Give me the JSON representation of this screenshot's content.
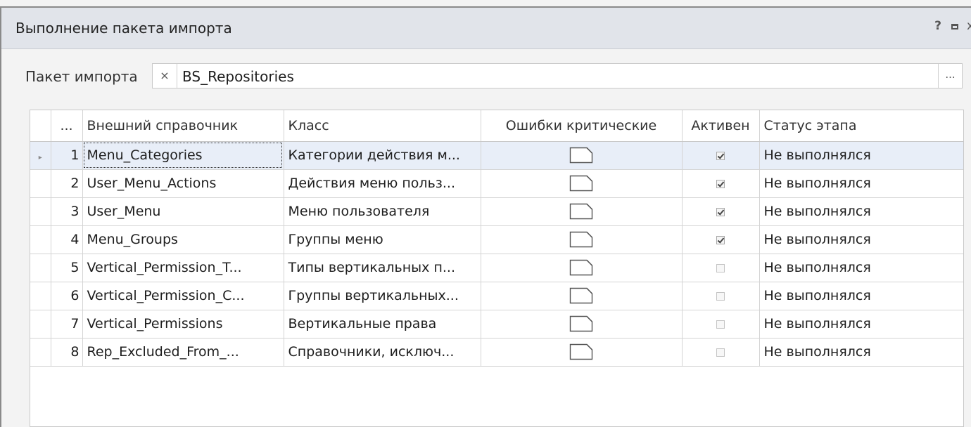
{
  "window": {
    "title": "Выполнение пакета импорта",
    "help_glyph": "?",
    "close_glyph": "x"
  },
  "package": {
    "label": "Пакет импорта",
    "clear_glyph": "×",
    "value": "BS_Repositories",
    "browse_glyph": "..."
  },
  "grid": {
    "columns": {
      "num": "...",
      "external": "Внешний справочник",
      "class": "Класс",
      "errors": "Ошибки критические",
      "active": "Активен",
      "status": "Статус этапа"
    },
    "rows": [
      {
        "num": "1",
        "external": "Menu_Categories",
        "class": "Категории действия м...",
        "active": true,
        "status": "Не выполнялся",
        "selected": true
      },
      {
        "num": "2",
        "external": "User_Menu_Actions",
        "class": "Действия меню польз...",
        "active": true,
        "status": "Не выполнялся"
      },
      {
        "num": "3",
        "external": "User_Menu",
        "class": "Меню пользователя",
        "active": true,
        "status": "Не выполнялся"
      },
      {
        "num": "4",
        "external": "Menu_Groups",
        "class": "Группы меню",
        "active": true,
        "status": "Не выполнялся"
      },
      {
        "num": "5",
        "external": "Vertical_Permission_T...",
        "class": "Типы вертикальных п...",
        "active": false,
        "status": "Не выполнялся"
      },
      {
        "num": "6",
        "external": "Vertical_Permission_C...",
        "class": "Группы вертикальных...",
        "active": false,
        "status": "Не выполнялся"
      },
      {
        "num": "7",
        "external": "Vertical_Permissions",
        "class": "Вертикальные права",
        "active": false,
        "status": "Не выполнялся"
      },
      {
        "num": "8",
        "external": "Rep_Excluded_From_...",
        "class": "Справочники, исключ...",
        "active": false,
        "status": "Не выполнялся"
      }
    ]
  },
  "icons": {
    "row_indicator": "caret-right-icon",
    "errors": "document-icon"
  },
  "colors": {
    "titlebar": "#e1e4ea",
    "selected_row": "#e8eef8"
  }
}
